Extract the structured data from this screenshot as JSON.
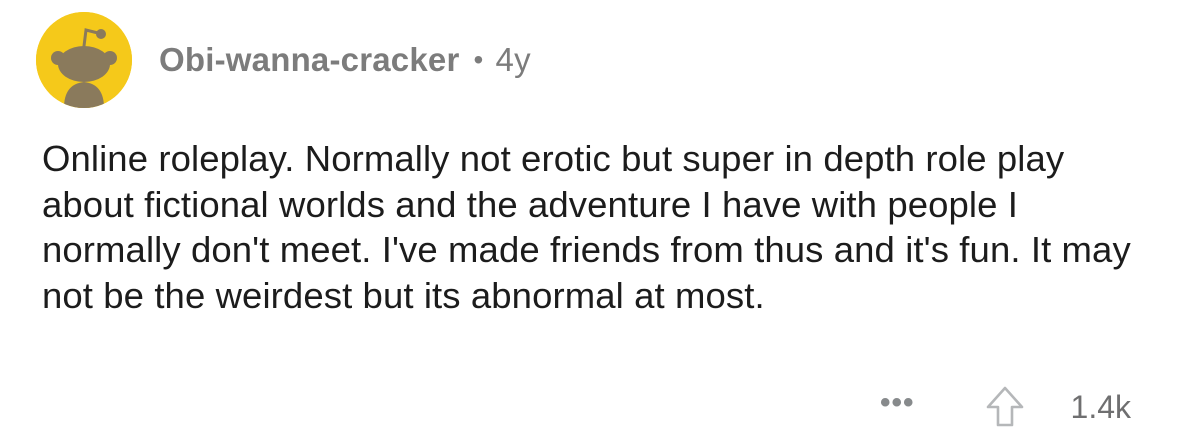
{
  "comment": {
    "author": "Obi-wanna-cracker",
    "separator": "•",
    "age": "4y",
    "avatar_icon": "snoo-avatar-icon",
    "avatar_color": "#f5c91a",
    "text": "Online roleplay. Normally not erotic but super in depth role play about fictional worlds and the adventure I have with people I normally don't meet. I've made friends from thus and it's fun. It may not be the weirdest but its abnormal at most.",
    "actions": {
      "more_label": "•••",
      "upvote_icon": "upvote-arrow-icon",
      "score": "1.4k"
    }
  }
}
